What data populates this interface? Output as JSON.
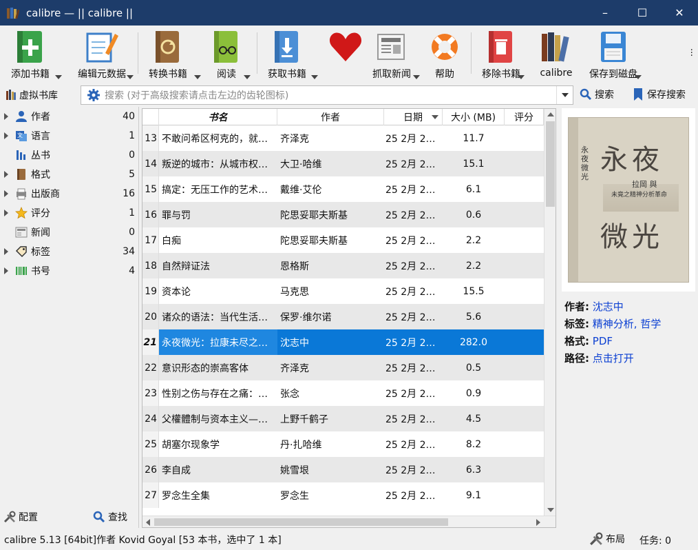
{
  "window": {
    "title": "calibre — || calibre ||",
    "minimize": "–",
    "maximize": "☐",
    "close": "✕"
  },
  "toolbar": {
    "items": [
      {
        "label": "添加书籍",
        "icon": "add-book-icon"
      },
      {
        "label": "编辑元数据",
        "icon": "edit-metadata-icon"
      },
      {
        "label": "转换书籍",
        "icon": "convert-book-icon"
      },
      {
        "label": "阅读",
        "icon": "read-book-icon"
      },
      {
        "label": "获取书籍",
        "icon": "get-books-icon"
      },
      {
        "label": "",
        "icon": "heart-icon"
      },
      {
        "label": "抓取新闻",
        "icon": "news-icon"
      },
      {
        "label": "帮助",
        "icon": "help-lifebuoy-icon"
      },
      {
        "label": "移除书籍",
        "icon": "remove-book-icon"
      },
      {
        "label": "calibre",
        "icon": "calibre-library-icon"
      },
      {
        "label": "保存到磁盘",
        "icon": "save-disk-icon"
      }
    ]
  },
  "search": {
    "virtual_library": "虚拟书库",
    "placeholder": "搜索 (对于高级搜索请点击左边的齿轮图标)",
    "search_button": "搜索",
    "save_search": "保存搜索"
  },
  "sidebar": {
    "items": [
      {
        "label": "作者",
        "count": "40",
        "icon": "person-icon",
        "expandable": true
      },
      {
        "label": "语言",
        "count": "1",
        "icon": "language-icon",
        "expandable": true
      },
      {
        "label": "丛书",
        "count": "0",
        "icon": "series-icon",
        "expandable": false
      },
      {
        "label": "格式",
        "count": "5",
        "icon": "format-book-icon",
        "expandable": true
      },
      {
        "label": "出版商",
        "count": "16",
        "icon": "publisher-icon",
        "expandable": true
      },
      {
        "label": "评分",
        "count": "1",
        "icon": "star-icon",
        "expandable": true
      },
      {
        "label": "新闻",
        "count": "0",
        "icon": "news-icon",
        "expandable": false
      },
      {
        "label": "标签",
        "count": "34",
        "icon": "tag-icon",
        "expandable": true
      },
      {
        "label": "书号",
        "count": "4",
        "icon": "barcode-icon",
        "expandable": true
      }
    ],
    "configure": "配置",
    "find": "查找"
  },
  "table": {
    "columns": [
      "书名",
      "作者",
      "日期",
      "大小 (MB)",
      "评分"
    ],
    "rows": [
      {
        "num": "13",
        "title": "不敢问希区柯克的，就…",
        "author": "齐泽克",
        "date": "25 2月 2…",
        "size": "11.7"
      },
      {
        "num": "14",
        "title": "叛逆的城市：从城市权…",
        "author": "大卫·哈维",
        "date": "25 2月 2…",
        "size": "15.1"
      },
      {
        "num": "15",
        "title": "搞定：无压工作的艺术…",
        "author": "戴维·艾伦",
        "date": "25 2月 2…",
        "size": "6.1"
      },
      {
        "num": "16",
        "title": "罪与罚",
        "author": "陀思妥耶夫斯基",
        "date": "25 2月 2…",
        "size": "0.6"
      },
      {
        "num": "17",
        "title": "白痴",
        "author": "陀思妥耶夫斯基",
        "date": "25 2月 2…",
        "size": "2.2"
      },
      {
        "num": "18",
        "title": "自然辩证法",
        "author": "恩格斯",
        "date": "25 2月 2…",
        "size": "2.2"
      },
      {
        "num": "19",
        "title": "资本论",
        "author": "马克思",
        "date": "25 2月 2…",
        "size": "15.5"
      },
      {
        "num": "20",
        "title": "诸众的语法：当代生活…",
        "author": "保罗·维尔诺",
        "date": "25 2月 2…",
        "size": "5.6"
      },
      {
        "num": "21",
        "title": "永夜微光：拉康未尽之…",
        "author": "沈志中",
        "date": "25 2月 2…",
        "size": "282.0",
        "selected": true
      },
      {
        "num": "22",
        "title": "意识形态的崇高客体",
        "author": "齐泽克",
        "date": "25 2月 2…",
        "size": "0.5"
      },
      {
        "num": "23",
        "title": "性别之伤与存在之痛：…",
        "author": "张念",
        "date": "25 2月 2…",
        "size": "0.9"
      },
      {
        "num": "24",
        "title": "父權體制与资本主义—…",
        "author": "上野千鹤子",
        "date": "25 2月 2…",
        "size": "4.5"
      },
      {
        "num": "25",
        "title": "胡塞尔现象学",
        "author": "丹·扎哈维",
        "date": "25 2月 2…",
        "size": "8.2"
      },
      {
        "num": "26",
        "title": "李自成",
        "author": "姚雪垠",
        "date": "25 2月 2…",
        "size": "6.3"
      },
      {
        "num": "27",
        "title": "罗念生全集",
        "author": "罗念生",
        "date": "25 2月 2…",
        "size": "9.1"
      }
    ]
  },
  "details": {
    "cover": {
      "title_top": "永夜",
      "title_bottom": "微光",
      "sub1": "拉岡",
      "sub1b": "與",
      "sub2": "未竟之精神分析革命",
      "vertical": "永夜微光"
    },
    "author_label": "作者:",
    "author_value": "沈志中",
    "tags_label": "标签:",
    "tags_value": "精神分析, 哲学",
    "format_label": "格式:",
    "format_value": "PDF",
    "path_label": "路径:",
    "path_value": "点击打开"
  },
  "statusbar": {
    "left": "calibre 5.13 [64bit]作者 Kovid Goyal   [53 本书，选中了 1 本]",
    "layout": "布局",
    "jobs": "任务:  0"
  },
  "colors": {
    "titlebar": "#1d3c6a",
    "selection": "#0a78d7",
    "link": "#0b3fd2"
  }
}
